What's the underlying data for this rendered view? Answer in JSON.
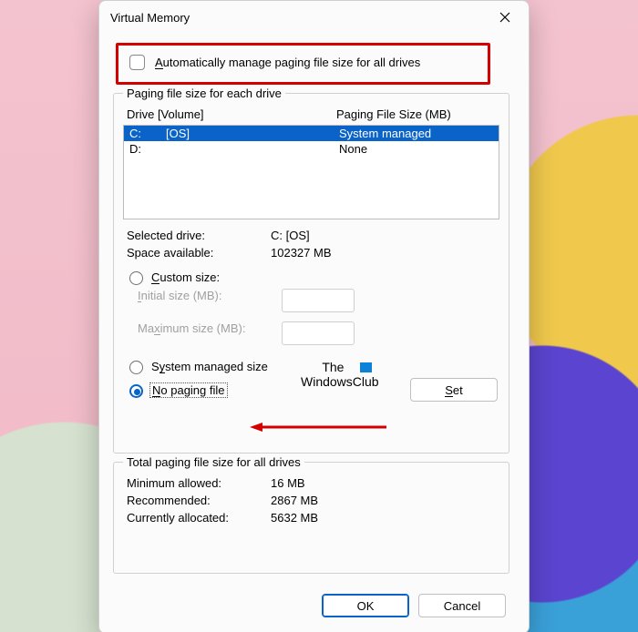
{
  "window": {
    "title": "Virtual Memory"
  },
  "auto": {
    "label_pre": "A",
    "label_post": "utomatically manage paging file size for all drives"
  },
  "fs1": {
    "legend": "Paging file size for each drive",
    "col_drive": "Drive  [Volume]",
    "col_pfs": "Paging File Size (MB)",
    "rows": [
      {
        "drive": "C:",
        "volume": "[OS]",
        "pfs": "System managed"
      },
      {
        "drive": "D:",
        "volume": "",
        "pfs": "None"
      }
    ],
    "selected_label": "Selected drive:",
    "selected_value": "C:  [OS]",
    "space_label": "Space available:",
    "space_value": "102327 MB",
    "custom_pre": "C",
    "custom_post": "ustom size:",
    "initial_pre": "I",
    "initial_post": "nitial size (MB):",
    "max_pre": "Ma",
    "max_u": "x",
    "max_post": "imum size (MB):",
    "sys_pre": "S",
    "sys_u": "y",
    "sys_post": "stem managed size",
    "nopf_pre": "N",
    "nopf_post": "o paging file",
    "set_pre": "S",
    "set_post": "et"
  },
  "fs2": {
    "legend": "Total paging file size for all drives",
    "min_label": "Minimum allowed:",
    "min_value": "16 MB",
    "rec_label": "Recommended:",
    "rec_value": "2867 MB",
    "cur_label": "Currently allocated:",
    "cur_value": "5632 MB"
  },
  "footer": {
    "ok": "OK",
    "cancel": "Cancel"
  },
  "watermark": {
    "line1": "The",
    "line2": "WindowsClub"
  }
}
